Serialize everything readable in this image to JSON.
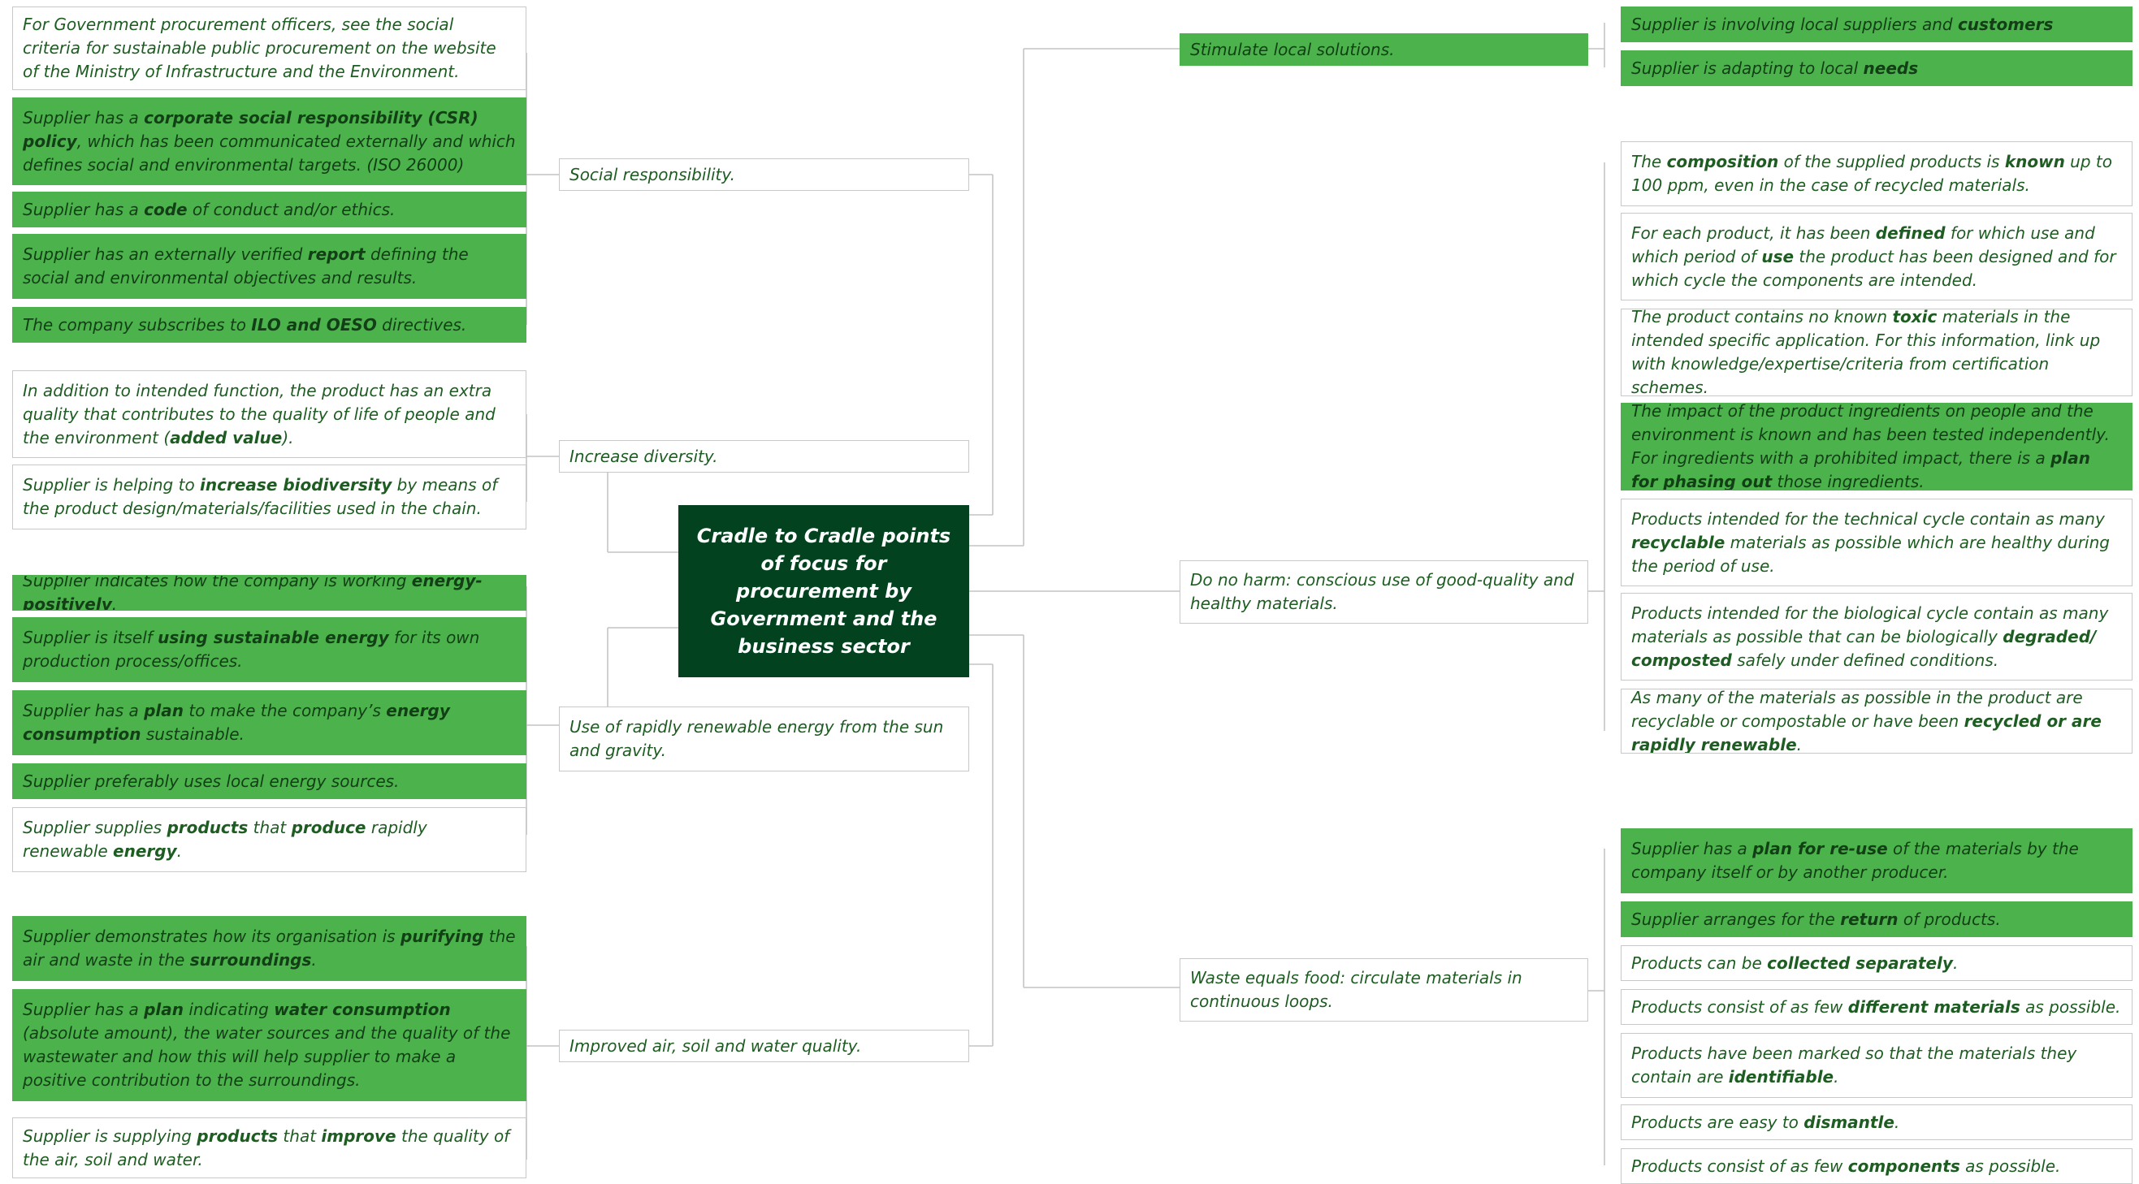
{
  "center": {
    "title": "Cradle to Cradle points of focus for procurement by Government and the business sector"
  },
  "categories": {
    "social": "Social responsibility.",
    "diversity": "Increase diversity.",
    "energy": "Use of rapidly renewable energy from the sun and gravity.",
    "air": "Improved air, soil and water quality.",
    "local": "Stimulate local solutions.",
    "noharm": "Do no harm: conscious use of good-quality and healthy materials.",
    "waste": "Waste equals food: circulate materials in continuous loops."
  },
  "items": {
    "s1": [
      {
        "t": "For Government procurement officers, see the social criteria for sustainable public procurement on the website of the Ministry of Infrastructure and the Environment."
      }
    ],
    "s2": [
      {
        "t": "Supplier has a "
      },
      {
        "t": "corporate social responsibility (CSR) policy",
        "b": true
      },
      {
        "t": ", which has been communicated externally and which defines social and environmental targets. (ISO 26000)"
      }
    ],
    "s3": [
      {
        "t": "Supplier has a "
      },
      {
        "t": "code",
        "b": true
      },
      {
        "t": " of conduct and/or ethics."
      }
    ],
    "s4": [
      {
        "t": "Supplier has an externally verified "
      },
      {
        "t": "report",
        "b": true
      },
      {
        "t": " defining the social and environmental objectives and results."
      }
    ],
    "s5": [
      {
        "t": "The company subscribes to "
      },
      {
        "t": "ILO and OESO",
        "b": true
      },
      {
        "t": " directives."
      }
    ],
    "d1": [
      {
        "t": "In addition to intended function, the product has an extra quality that contributes to the quality of life of people and the environment ("
      },
      {
        "t": "added value",
        "b": true
      },
      {
        "t": ")."
      }
    ],
    "d2": [
      {
        "t": "Supplier is helping to "
      },
      {
        "t": "increase biodiversity",
        "b": true
      },
      {
        "t": " by means of the product design/materials/facilities used in the chain."
      }
    ],
    "e1": [
      {
        "t": "Supplier indicates how the company is working "
      },
      {
        "t": "energy-positively",
        "b": true
      },
      {
        "t": "."
      }
    ],
    "e2": [
      {
        "t": "Supplier is itself "
      },
      {
        "t": "using sustainable energy",
        "b": true
      },
      {
        "t": " for its own production process/offices."
      }
    ],
    "e3": [
      {
        "t": "Supplier has a "
      },
      {
        "t": "plan",
        "b": true
      },
      {
        "t": " to make the company’s "
      },
      {
        "t": "energy consumption",
        "b": true
      },
      {
        "t": " sustainable."
      }
    ],
    "e4": [
      {
        "t": "Supplier preferably uses local energy sources."
      }
    ],
    "e5": [
      {
        "t": "Supplier supplies "
      },
      {
        "t": "products",
        "b": true
      },
      {
        "t": " that "
      },
      {
        "t": "produce",
        "b": true
      },
      {
        "t": " rapidly renewable "
      },
      {
        "t": "energy",
        "b": true
      },
      {
        "t": "."
      }
    ],
    "a1": [
      {
        "t": "Supplier demonstrates how its organisation is "
      },
      {
        "t": "purifying",
        "b": true
      },
      {
        "t": " the air and waste in the "
      },
      {
        "t": "surroundings",
        "b": true
      },
      {
        "t": "."
      }
    ],
    "a2": [
      {
        "t": "Supplier has a "
      },
      {
        "t": "plan",
        "b": true
      },
      {
        "t": " indicating "
      },
      {
        "t": "water consumption",
        "b": true
      },
      {
        "t": " (absolute amount), the water sources and the quality of the wastewater and how this will help supplier to make a positive contribution to the surroundings."
      }
    ],
    "a3": [
      {
        "t": "Supplier is supplying "
      },
      {
        "t": "products",
        "b": true
      },
      {
        "t": " that "
      },
      {
        "t": "improve",
        "b": true
      },
      {
        "t": " the quality of the air, soil and water."
      }
    ],
    "l1": [
      {
        "t": "Supplier is involving local suppliers and "
      },
      {
        "t": "customers",
        "b": true
      }
    ],
    "l2": [
      {
        "t": "Supplier is adapting to local "
      },
      {
        "t": "needs",
        "b": true
      }
    ],
    "n1": [
      {
        "t": "The "
      },
      {
        "t": "composition",
        "b": true
      },
      {
        "t": " of the supplied products is "
      },
      {
        "t": "known",
        "b": true
      },
      {
        "t": " up to 100 ppm, even in the case of recycled materials."
      }
    ],
    "n2": [
      {
        "t": "For each product, it has been "
      },
      {
        "t": "defined",
        "b": true
      },
      {
        "t": " for which use and which period of "
      },
      {
        "t": "use",
        "b": true
      },
      {
        "t": " the product has been designed and for which cycle the components are intended."
      }
    ],
    "n3": [
      {
        "t": "The product contains no known "
      },
      {
        "t": "toxic",
        "b": true
      },
      {
        "t": " materials in the intended specific application. For this information, link up with knowledge/expertise/criteria from certification schemes."
      }
    ],
    "n4": [
      {
        "t": "The impact of the product ingredients on people and the environment is known and has been tested independently. For ingredients with a prohibited impact, there is a "
      },
      {
        "t": "plan for phasing out",
        "b": true
      },
      {
        "t": " those ingredients."
      }
    ],
    "n5": [
      {
        "t": "Products intended for the technical cycle contain as many "
      },
      {
        "t": "recyclable",
        "b": true
      },
      {
        "t": " materials as possible which are healthy during the period of use."
      }
    ],
    "n6": [
      {
        "t": "Products intended for the biological cycle contain as many materials as possible that can be biologically "
      },
      {
        "t": "degraded/ composted",
        "b": true
      },
      {
        "t": " safely under defined conditions."
      }
    ],
    "n7": [
      {
        "t": "As many of the materials as possible in the product are recyclable or compostable or have been "
      },
      {
        "t": "recycled or are rapidly renewable",
        "b": true
      },
      {
        "t": "."
      }
    ],
    "w1": [
      {
        "t": "Supplier has a "
      },
      {
        "t": "plan for re-use",
        "b": true
      },
      {
        "t": " of the materials by the company itself or by another producer."
      }
    ],
    "w2": [
      {
        "t": "Supplier arranges for the "
      },
      {
        "t": "return",
        "b": true
      },
      {
        "t": " of products."
      }
    ],
    "w3": [
      {
        "t": "Products can be "
      },
      {
        "t": "collected separately",
        "b": true
      },
      {
        "t": "."
      }
    ],
    "w4": [
      {
        "t": "Products consist of as few "
      },
      {
        "t": "different materials",
        "b": true
      },
      {
        "t": " as possible."
      }
    ],
    "w5": [
      {
        "t": "Products have been marked so that the materials they contain are "
      },
      {
        "t": "identifiable",
        "b": true
      },
      {
        "t": "."
      }
    ],
    "w6": [
      {
        "t": "Products are easy to "
      },
      {
        "t": "dismantle",
        "b": true
      },
      {
        "t": "."
      }
    ],
    "w7": [
      {
        "t": "Products consist of as few "
      },
      {
        "t": "components",
        "b": true
      },
      {
        "t": " as possible."
      }
    ]
  },
  "colors": {
    "dark_green": "#03421f",
    "green": "#4cb34c",
    "text_green": "#1e5d22",
    "line_gray": "#c4c4c4"
  }
}
